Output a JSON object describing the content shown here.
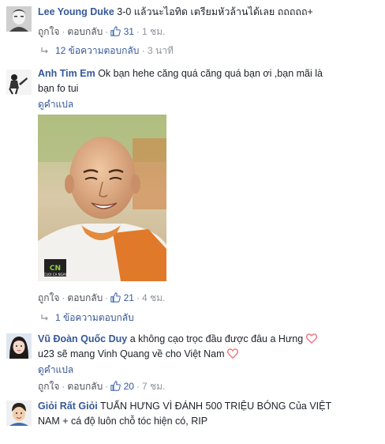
{
  "comments": [
    {
      "author": "Lee Young Duke",
      "text": "3-0 แล้วนะไอทิด เตรียมหัวล้านได้เลย ถถถถถ+",
      "like_label": "ถูกใจ",
      "reply_label": "ตอบกลับ",
      "likes": "31",
      "time": "1 ชม.",
      "replies_label": "12 ข้อความตอบกลับ",
      "replies_time": "3 นาที"
    },
    {
      "author": "Anh Tim Em",
      "text_line1": "Ok bạn hehe căng quá căng quá bạn ơi ,bạn mãi là",
      "text_line2": "bạn fo tui",
      "translate_label": "ดูคำแปล",
      "like_label": "ถูกใจ",
      "reply_label": "ตอบกลับ",
      "likes": "21",
      "time": "4 ชม.",
      "replies_label": "1 ข้อความตอบกลับ",
      "photo_logo": "CN",
      "photo_logo_sub": "CUOI CA NGAY"
    },
    {
      "author": "Vũ Đoàn Quốc Duy",
      "text_line1": "a không cạo trọc đầu được đâu a Hưng",
      "text_line2": "u23 sẽ mang Vinh Quang về cho Việt Nam",
      "translate_label": "ดูคำแปล",
      "like_label": "ถูกใจ",
      "reply_label": "ตอบกลับ",
      "likes": "20",
      "time": "7 ชม."
    },
    {
      "author": "Giỏi Rất Giỏi",
      "text_line1": "TUẤN HƯNG VÌ ĐÁNH 500 TRIỆU BÓNG Của VIỆT",
      "text_line2": "NAM + cá độ luôn chỗ tóc hiện có, RIP"
    }
  ],
  "icons": {
    "like": "thumbs-up-icon",
    "heart": "heart-icon",
    "reply": "reply-arrow-icon"
  },
  "colors": {
    "link": "#365899",
    "meta": "#90949c",
    "text": "#1d2129",
    "heart": "#f0747e"
  }
}
